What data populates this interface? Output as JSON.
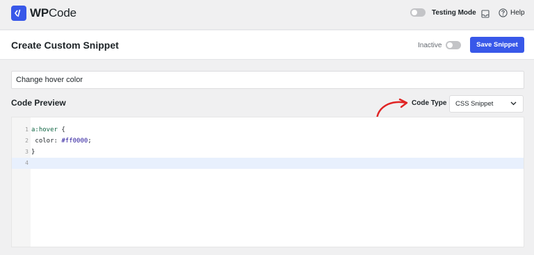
{
  "app": {
    "logo_wp": "WP",
    "logo_code": "Code"
  },
  "topbar": {
    "testing_mode_label": "Testing Mode",
    "testing_mode_on": false,
    "help_label": "Help"
  },
  "header": {
    "page_title": "Create Custom Snippet",
    "status_label": "Inactive",
    "active": false,
    "save_label": "Save Snippet"
  },
  "snippet": {
    "title_value": "Change hover color"
  },
  "code_preview": {
    "title": "Code Preview",
    "code_type_label": "Code Type",
    "code_type_value": "CSS Snippet",
    "lines": [
      {
        "number": "1",
        "selector": "a:hover",
        "rest": " {"
      },
      {
        "number": "2",
        "property": " color:",
        "value": " #ff0000",
        "end": ";"
      },
      {
        "number": "3",
        "text": "}"
      },
      {
        "number": "4",
        "text": ""
      }
    ],
    "active_line": 4
  },
  "colors": {
    "accent": "#3858e9",
    "annotation_arrow": "#e02424",
    "active_line_bg": "#e8f0fd"
  },
  "icons": {
    "logo": "code-bracket-icon",
    "inbox": "inbox-icon",
    "help": "question-circle-icon",
    "dropdown": "chevron-down-icon",
    "annotation": "curved-arrow-icon"
  }
}
